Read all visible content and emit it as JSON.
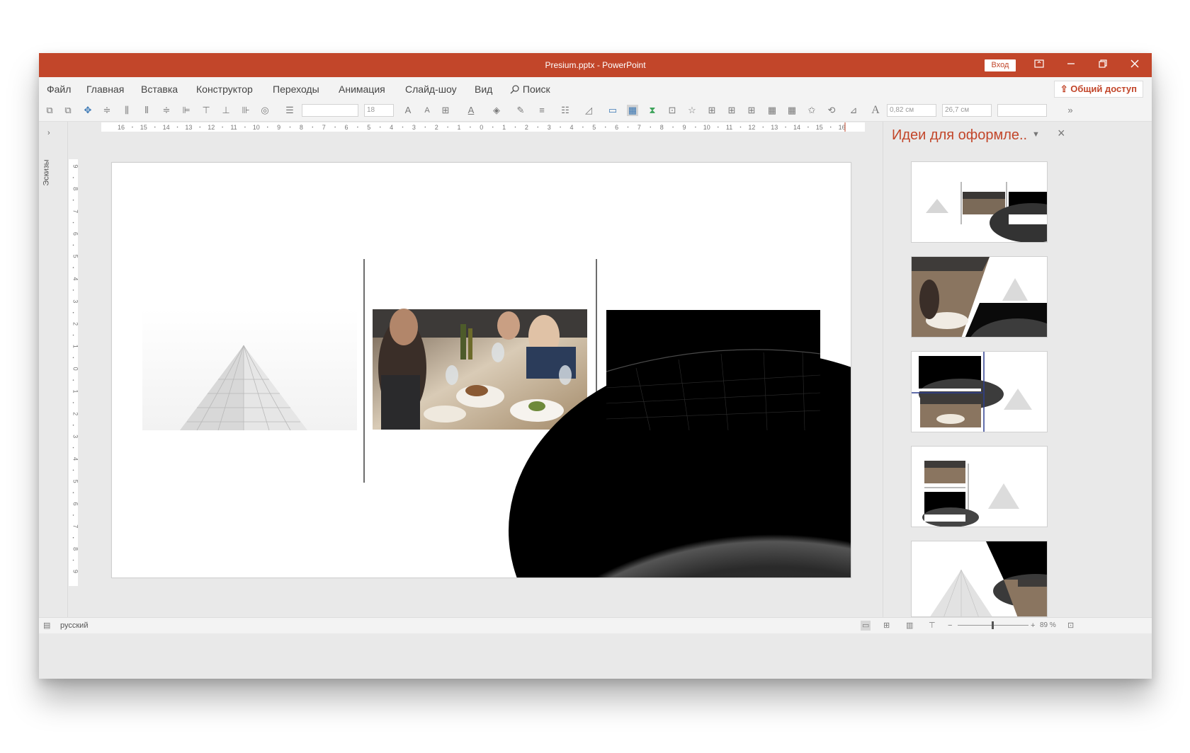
{
  "titlebar": {
    "title": "Presium.pptx - PowerPoint",
    "signin": "Вход",
    "accent_color": "#c2462a"
  },
  "menu": {
    "items": [
      "Файл",
      "Главная",
      "Вставка",
      "Конструктор",
      "Переходы",
      "Анимация",
      "Слайд-шоу",
      "Вид"
    ],
    "search_label": "Поиск",
    "share_label": "Общий доступ"
  },
  "toolbar": {
    "font_size": "18",
    "height_value": "0,82 см",
    "width_value": "26,7 см"
  },
  "left_panel": {
    "label": "Эскизы"
  },
  "ruler": {
    "h_labels": [
      "16",
      "15",
      "14",
      "13",
      "12",
      "11",
      "10",
      "9",
      "8",
      "7",
      "6",
      "5",
      "4",
      "3",
      "2",
      "1",
      "0",
      "1",
      "2",
      "3",
      "4",
      "5",
      "6",
      "7",
      "8",
      "9",
      "10",
      "11",
      "12",
      "13",
      "14",
      "15",
      "16"
    ],
    "v_labels": [
      "9",
      "8",
      "7",
      "6",
      "5",
      "4",
      "3",
      "2",
      "1",
      "0",
      "1",
      "2",
      "3",
      "4",
      "5",
      "6",
      "7",
      "8",
      "9"
    ]
  },
  "design_panel": {
    "title": "Идеи для оформле..",
    "thumbnail_count": 5
  },
  "status": {
    "language": "русский",
    "zoom": "89 %"
  }
}
